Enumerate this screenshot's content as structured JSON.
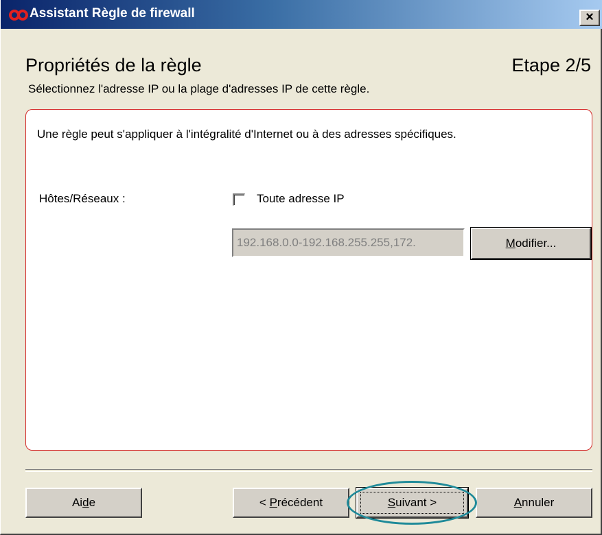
{
  "window": {
    "title": "Assistant Règle de firewall",
    "close_label": "×"
  },
  "header": {
    "heading": "Propriétés de la règle",
    "step": "Etape 2/5",
    "subtitle": "Sélectionnez l'adresse IP ou la plage d'adresses IP de cette règle."
  },
  "panel": {
    "intro": "Une règle peut s'appliquer à l'intégralité d'Internet ou à des adresses spécifiques.",
    "hosts_label": "Hôtes/Réseaux :",
    "any_ip_label": "Toute adresse IP",
    "any_ip_checked": false,
    "ip_range_value": "192.168.0.0-192.168.255.255,172.",
    "modify_button": {
      "mnemonic": "M",
      "rest": "odifier..."
    }
  },
  "footer": {
    "help_button": {
      "before": "Ai",
      "mnemonic": "d",
      "after": "e"
    },
    "prev_button": {
      "before": "< ",
      "mnemonic": "P",
      "after": "récédent"
    },
    "next_button": {
      "before": "",
      "mnemonic": "S",
      "after": "uivant >"
    },
    "cancel_button": {
      "before": "",
      "mnemonic": "A",
      "after": "nnuler"
    }
  },
  "colors": {
    "panel_border": "#d42a2a",
    "highlight_ring": "#1f8a99",
    "title_gradient_start": "#0a246a"
  },
  "icons": [
    "app-logo-icon",
    "close-icon"
  ]
}
